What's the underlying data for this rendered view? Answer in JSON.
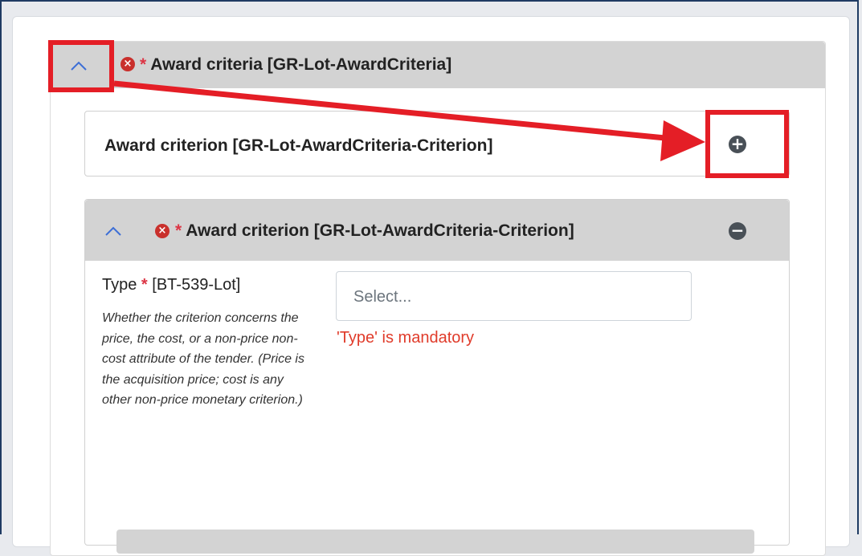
{
  "award_criteria": {
    "required_marker": "*",
    "title": "Award criteria  [GR-Lot-AwardCriteria]",
    "error_icon": "x-circle-icon",
    "toggle_icon": "chevron-up-icon"
  },
  "criterion_add_row": {
    "title": "Award criterion  [GR-Lot-AwardCriteria-Criterion]",
    "add_icon": "plus-circle-icon",
    "add_symbol": "+"
  },
  "criterion_item": {
    "required_marker": "*",
    "title": "Award criterion  [GR-Lot-AwardCriteria-Criterion]",
    "remove_icon": "minus-circle-icon",
    "remove_symbol": "−",
    "toggle_icon": "chevron-up-icon"
  },
  "type_field": {
    "label": "Type",
    "required_marker": "*",
    "code": "[BT-539-Lot]",
    "help": "Whether the criterion concerns the price, the cost, or a non-price non-cost attribute of the tender. (Price is the acquisition price; cost is any other non-price monetary criterion.)",
    "placeholder": "Select...",
    "error": "'Type' is mandatory"
  },
  "annotation": {
    "color": "#e41e26"
  }
}
